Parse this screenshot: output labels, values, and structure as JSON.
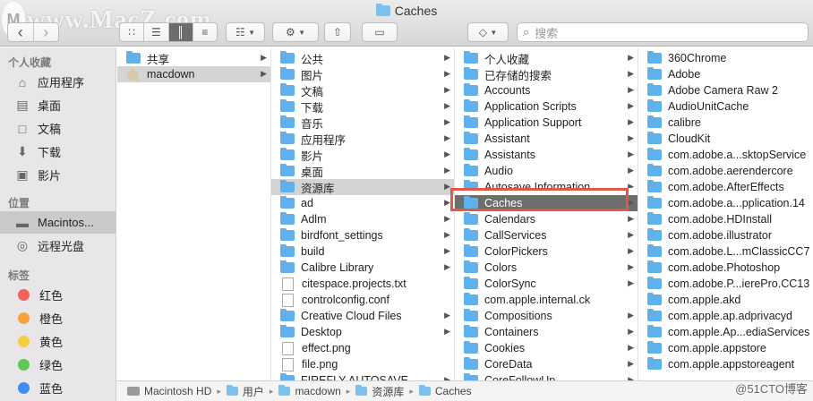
{
  "window": {
    "title": "Caches"
  },
  "watermark": {
    "text": "www.MacZ.com",
    "logo": "M"
  },
  "toolbar": {
    "back": "‹",
    "fwd": "›",
    "view_icons": "∷",
    "view_list": "☰",
    "view_cols": "║",
    "view_gallery": "≡",
    "group": "☷",
    "action": "⚙",
    "share": "⇧",
    "tag": "▭",
    "dropbox": "◇",
    "search_placeholder": "搜索",
    "search_icon": "⌕"
  },
  "sidebar": {
    "sections": [
      {
        "title": "个人收藏",
        "items": [
          {
            "label": "应用程序",
            "icon": "⌂"
          },
          {
            "label": "桌面",
            "icon": "▤"
          },
          {
            "label": "文稿",
            "icon": "□"
          },
          {
            "label": "下载",
            "icon": "⬇"
          },
          {
            "label": "影片",
            "icon": "▣"
          }
        ]
      },
      {
        "title": "位置",
        "items": [
          {
            "label": "Macintos...",
            "icon": "▬"
          },
          {
            "label": "远程光盘",
            "icon": "◎"
          }
        ]
      },
      {
        "title": "标签",
        "items": [
          {
            "label": "红色",
            "color": "#f2625b"
          },
          {
            "label": "橙色",
            "color": "#f7a23c"
          },
          {
            "label": "黄色",
            "color": "#f5cd3d"
          },
          {
            "label": "绿色",
            "color": "#5fc856"
          },
          {
            "label": "蓝色",
            "color": "#3e8ef0"
          }
        ]
      }
    ]
  },
  "columns": {
    "c1": [
      {
        "label": "共享",
        "kind": "folder"
      },
      {
        "label": "macdown",
        "kind": "home"
      }
    ],
    "c2": [
      "公共",
      "图片",
      "文稿",
      "下载",
      "音乐",
      "应用程序",
      "影片",
      "桌面",
      "资源库",
      "ad",
      "Adlm",
      "birdfont_settings",
      "build",
      "Calibre Library",
      "citespace.projects.txt",
      "controlconfig.conf",
      "Creative Cloud Files",
      "Desktop",
      "effect.png",
      "file.png",
      "FIREFLY AUTOSAVE"
    ],
    "c3": [
      "个人收藏",
      "已存储的搜索",
      "Accounts",
      "Application Scripts",
      "Application Support",
      "Assistant",
      "Assistants",
      "Audio",
      "Autosave Information",
      "Caches",
      "Calendars",
      "CallServices",
      "ColorPickers",
      "Colors",
      "ColorSync",
      "com.apple.internal.ck",
      "Compositions",
      "Containers",
      "Cookies",
      "CoreData",
      "CoreFollowUp"
    ],
    "c4": [
      "360Chrome",
      "Adobe",
      "Adobe Camera Raw 2",
      "AudioUnitCache",
      "calibre",
      "CloudKit",
      "com.adobe.a...sktopService",
      "com.adobe.aerendercore",
      "com.adobe.AfterEffects",
      "com.adobe.a...pplication.14",
      "com.adobe.HDInstall",
      "com.adobe.illustrator",
      "com.adobe.L...mClassicCC7",
      "com.adobe.Photoshop",
      "com.adobe.P...ierePro.CC13",
      "com.apple.akd",
      "com.apple.ap.adprivacyd",
      "com.apple.Ap...ediaServices",
      "com.apple.appstore",
      "com.apple.appstoreagent"
    ]
  },
  "pathbar": [
    "Macintosh HD",
    "用户",
    "macdown",
    "资源库",
    "Caches"
  ],
  "corner_watermark": "@51CTO博客"
}
